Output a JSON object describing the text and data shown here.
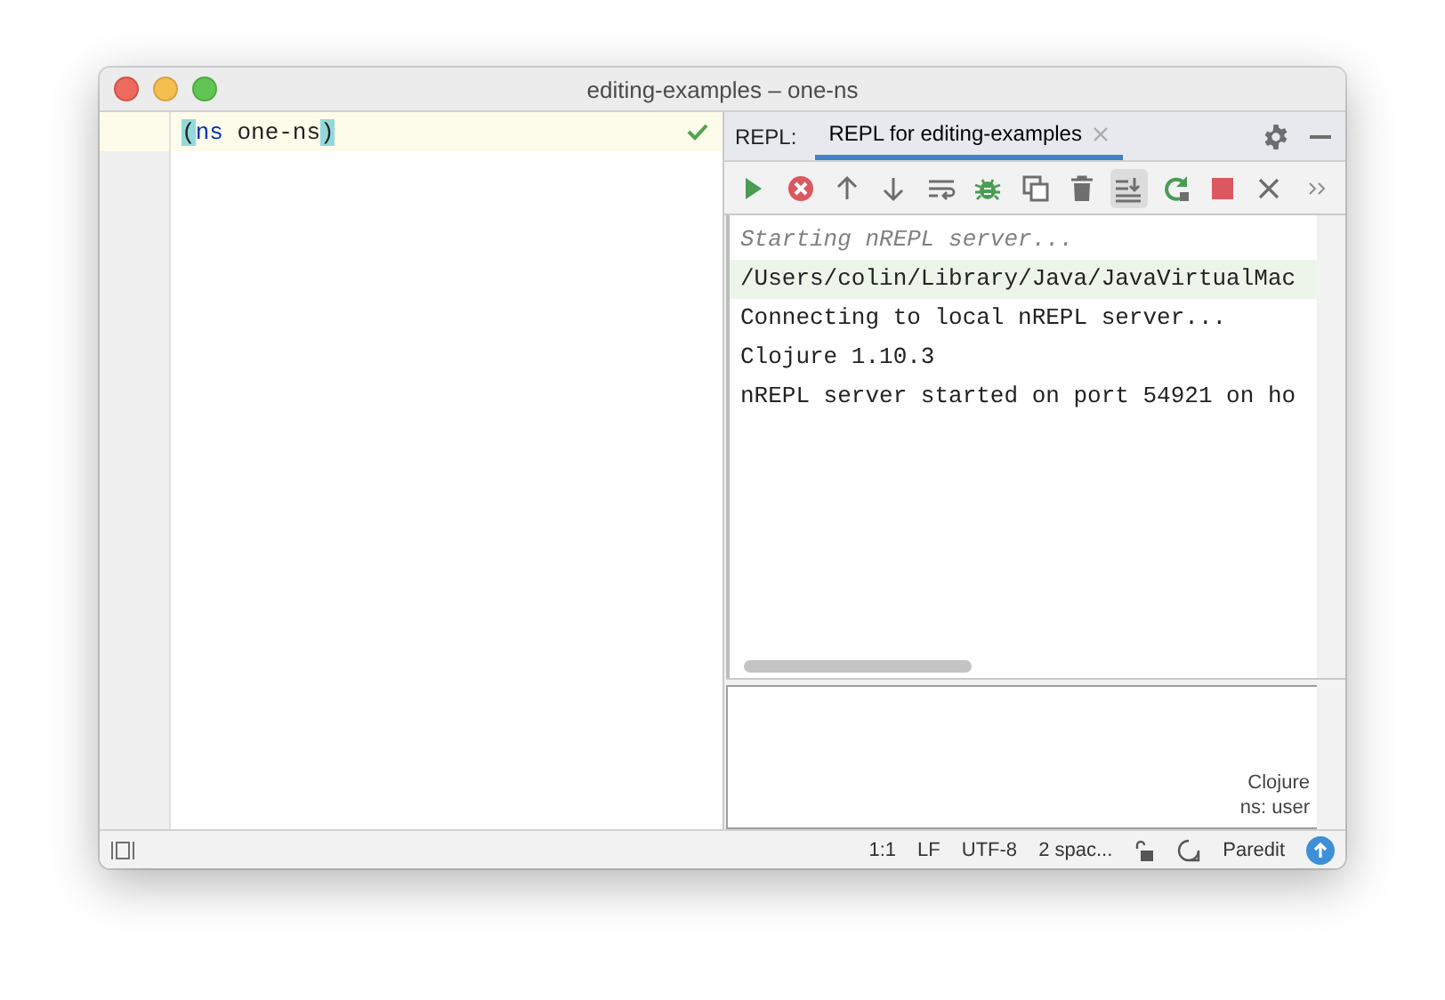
{
  "window": {
    "title": "editing-examples – one-ns"
  },
  "editor": {
    "current_line": true,
    "tokens": [
      {
        "text": "(",
        "kind": "brace"
      },
      {
        "text": "ns",
        "kind": "keyword"
      },
      {
        "text": " one-ns",
        "kind": "plain"
      },
      {
        "text": ")",
        "kind": "brace"
      }
    ],
    "inspection_ok": true
  },
  "repl": {
    "label": "REPL:",
    "tabs": [
      {
        "label": "REPL for editing-examples",
        "selected": true,
        "closable": true
      }
    ],
    "toolbar": [
      {
        "kind": "run",
        "on": false
      },
      {
        "kind": "stop-circle",
        "on": false
      },
      {
        "kind": "up",
        "on": false
      },
      {
        "kind": "down",
        "on": false
      },
      {
        "kind": "wrap",
        "on": false
      },
      {
        "kind": "bug",
        "on": false
      },
      {
        "kind": "copy",
        "on": false
      },
      {
        "kind": "trash",
        "on": false
      },
      {
        "kind": "scroll-end",
        "on": true
      },
      {
        "kind": "rerun",
        "on": false
      },
      {
        "kind": "stop",
        "on": false
      },
      {
        "kind": "close",
        "on": false
      },
      {
        "kind": "more",
        "on": false
      }
    ],
    "output": [
      {
        "text": "Starting nREPL server...",
        "kind": "info"
      },
      {
        "text": "/Users/colin/Library/Java/JavaVirtualMac",
        "kind": "highlight"
      },
      {
        "text": "Connecting to local nREPL server...",
        "kind": "plain"
      },
      {
        "text": "Clojure 1.10.3",
        "kind": "plain"
      },
      {
        "text": "nREPL server started on port 54921 on ho",
        "kind": "plain"
      }
    ],
    "input": {
      "language": "Clojure",
      "namespace": "ns: user"
    }
  },
  "status_bar": {
    "items": [
      "1:1",
      "LF",
      "UTF-8",
      "2 spac..."
    ],
    "mode": "Paredit"
  }
}
